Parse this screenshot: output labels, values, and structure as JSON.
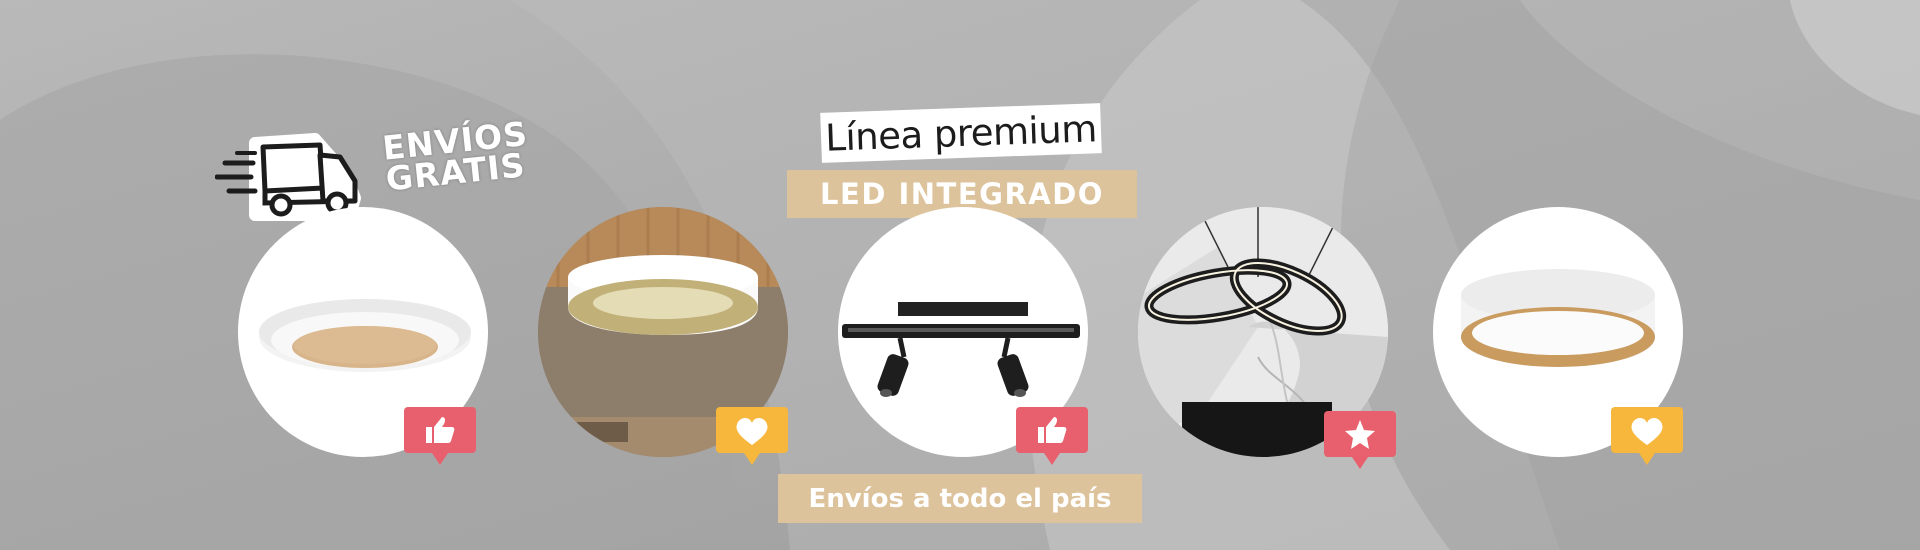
{
  "shipping_badge": {
    "line1": "ENVÍOS",
    "line2": "GRATIS",
    "icon": "delivery-truck-icon"
  },
  "title": "Línea premium",
  "tagline": "LED INTEGRADO",
  "footer_label": "Envíos a todo el país",
  "products": [
    {
      "name": "round ceiling lamp with wood center",
      "reaction_icon": "thumbs-up-icon",
      "reaction_color": "#e8606d"
    },
    {
      "name": "white and gold ring ceiling lamp",
      "reaction_icon": "heart-icon",
      "reaction_color": "#f6b73c"
    },
    {
      "name": "black bar lamp with two spotlights",
      "reaction_icon": "thumbs-up-icon",
      "reaction_color": "#e8606d"
    },
    {
      "name": "black infinity ring pendant lamp",
      "reaction_icon": "star-icon",
      "reaction_color": "#e8606d"
    },
    {
      "name": "white drum ceiling lamp with wood interior",
      "reaction_icon": "heart-icon",
      "reaction_color": "#f6b73c"
    }
  ],
  "colors": {
    "background": "#a9a9a9",
    "accent_beige": "#ddc39c",
    "reaction_red": "#e8606d",
    "reaction_yellow": "#f6b73c"
  }
}
